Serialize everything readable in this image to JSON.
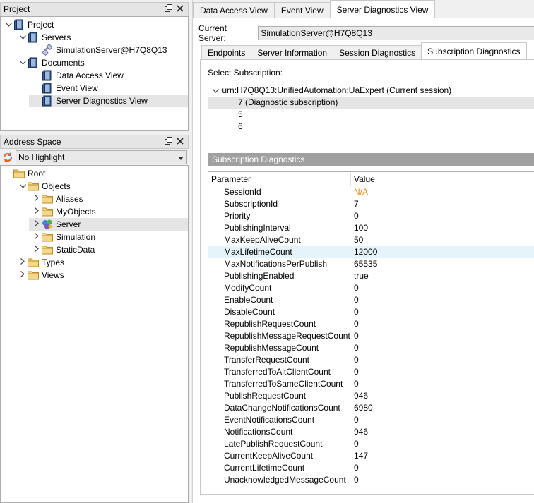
{
  "project_panel": {
    "title": "Project",
    "tree": [
      {
        "label": "Project",
        "level": 0,
        "expanded": true,
        "icon": "project-icon"
      },
      {
        "label": "Servers",
        "level": 1,
        "expanded": true,
        "icon": "servers-icon"
      },
      {
        "label": "SimulationServer@H7Q8Q13",
        "level": 2,
        "icon": "server-connection-icon"
      },
      {
        "label": "Documents",
        "level": 1,
        "expanded": true,
        "icon": "documents-icon"
      },
      {
        "label": "Data Access View",
        "level": 2,
        "icon": "document-icon"
      },
      {
        "label": "Event View",
        "level": 2,
        "icon": "document-icon"
      },
      {
        "label": "Server Diagnostics View",
        "level": 2,
        "icon": "document-icon",
        "selected": true
      }
    ]
  },
  "address_panel": {
    "title": "Address Space",
    "highlight_select": "No Highlight",
    "tree": [
      {
        "label": "Root",
        "level": 0,
        "icon": "folder-icon"
      },
      {
        "label": "Objects",
        "level": 1,
        "expanded": true,
        "icon": "folder-icon"
      },
      {
        "label": "Aliases",
        "level": 2,
        "collapsed": true,
        "icon": "folder-icon"
      },
      {
        "label": "MyObjects",
        "level": 2,
        "collapsed": true,
        "icon": "folder-icon"
      },
      {
        "label": "Server",
        "level": 2,
        "collapsed": true,
        "icon": "server-object-icon",
        "selected": true
      },
      {
        "label": "Simulation",
        "level": 2,
        "collapsed": true,
        "icon": "folder-icon"
      },
      {
        "label": "StaticData",
        "level": 2,
        "collapsed": true,
        "icon": "folder-icon"
      },
      {
        "label": "Types",
        "level": 1,
        "collapsed": true,
        "icon": "folder-icon"
      },
      {
        "label": "Views",
        "level": 1,
        "collapsed": true,
        "icon": "folder-icon"
      }
    ]
  },
  "top_tabs": [
    "Data Access View",
    "Event View",
    "Server Diagnostics View"
  ],
  "current_server": {
    "label": "Current Server:",
    "value": "SimulationServer@H7Q8Q13"
  },
  "sub_tabs": [
    "Endpoints",
    "Server Information",
    "Session Diagnostics",
    "Subscription Diagnostics"
  ],
  "select_subscription": {
    "label": "Select Subscription:",
    "root": "urn:H7Q8Q13:UnifiedAutomation:UaExpert (Current session)",
    "children": [
      "7 (Diagnostic subscription)",
      "5",
      "6"
    ]
  },
  "section_header": "Subscription Diagnostics",
  "grid": {
    "col_param": "Parameter",
    "col_value": "Value",
    "rows": [
      {
        "param": "SessionId",
        "value": "N/A",
        "warn": true
      },
      {
        "param": "SubscriptionId",
        "value": "7"
      },
      {
        "param": "Priority",
        "value": "0"
      },
      {
        "param": "PublishingInterval",
        "value": "100"
      },
      {
        "param": "MaxKeepAliveCount",
        "value": "50"
      },
      {
        "param": "MaxLifetimeCount",
        "value": "12000",
        "highlight": true
      },
      {
        "param": "MaxNotificationsPerPublish",
        "value": "65535"
      },
      {
        "param": "PublishingEnabled",
        "value": "true"
      },
      {
        "param": "ModifyCount",
        "value": "0"
      },
      {
        "param": "EnableCount",
        "value": "0"
      },
      {
        "param": "DisableCount",
        "value": "0"
      },
      {
        "param": "RepublishRequestCount",
        "value": "0"
      },
      {
        "param": "RepublishMessageRequestCount",
        "value": "0"
      },
      {
        "param": "RepublishMessageCount",
        "value": "0"
      },
      {
        "param": "TransferRequestCount",
        "value": "0"
      },
      {
        "param": "TransferredToAltClientCount",
        "value": "0"
      },
      {
        "param": "TransferredToSameClientCount",
        "value": "0"
      },
      {
        "param": "PublishRequestCount",
        "value": "946"
      },
      {
        "param": "DataChangeNotificationsCount",
        "value": "6980"
      },
      {
        "param": "EventNotificationsCount",
        "value": "0"
      },
      {
        "param": "NotificationsCount",
        "value": "946"
      },
      {
        "param": "LatePublishRequestCount",
        "value": "0"
      },
      {
        "param": "CurrentKeepAliveCount",
        "value": "147"
      },
      {
        "param": "CurrentLifetimeCount",
        "value": "0"
      },
      {
        "param": "UnacknowledgedMessageCount",
        "value": "0"
      }
    ]
  },
  "colors": {
    "warn": "#e8891d",
    "selection": "#e5e5e5",
    "highlight_row": "#e5f3fb",
    "section_header": "#a0a0a0"
  }
}
